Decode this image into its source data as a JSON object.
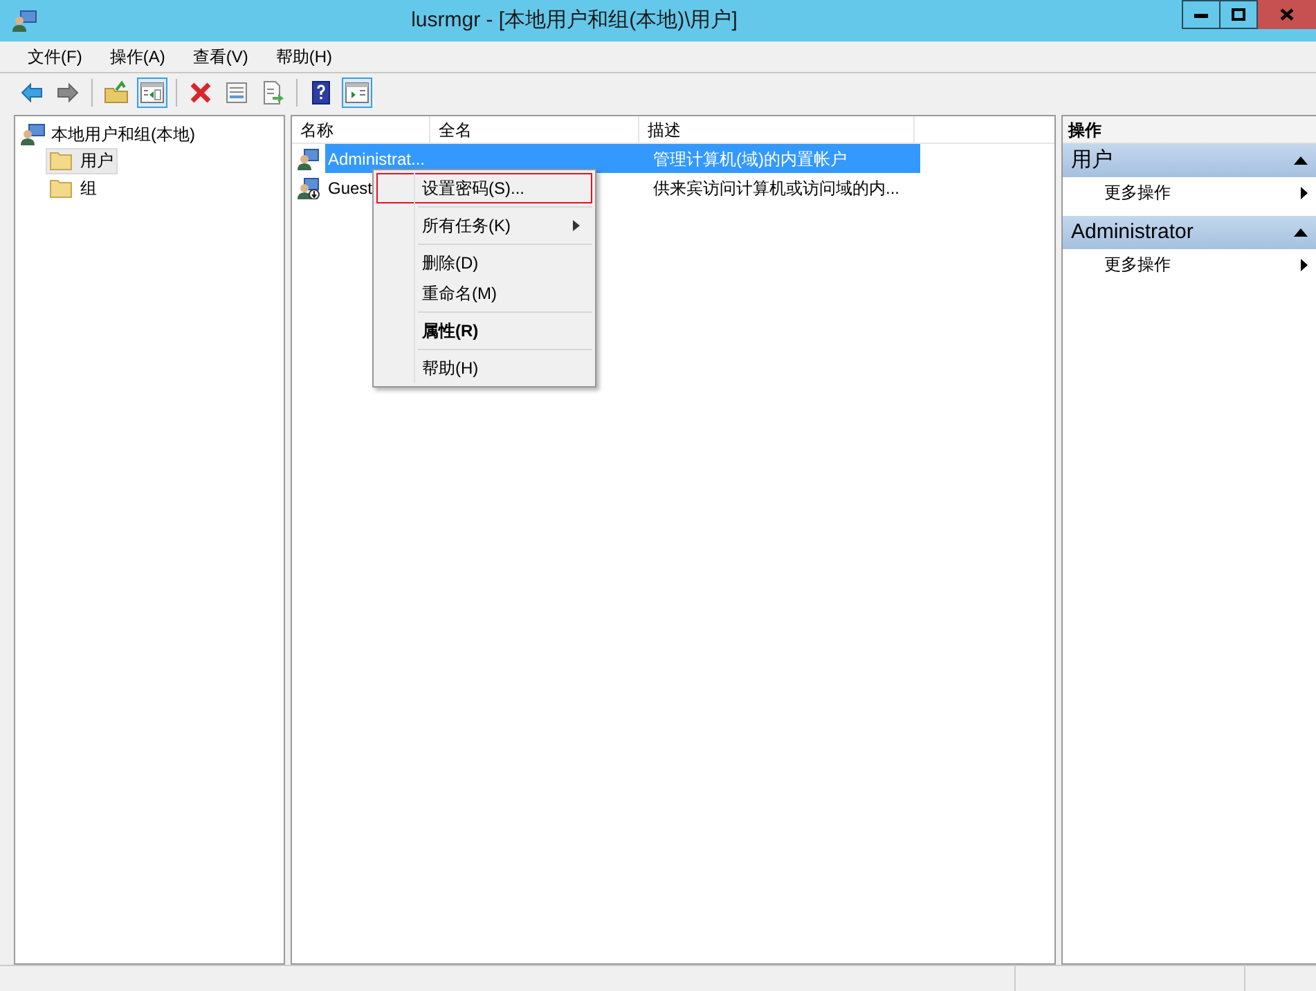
{
  "window": {
    "title": "lusrmgr - [本地用户和组(本地)\\用户]"
  },
  "menu_bar": [
    "文件(F)",
    "操作(A)",
    "查看(V)",
    "帮助(H)"
  ],
  "toolbar": [
    {
      "kind": "back",
      "pressed": false
    },
    {
      "kind": "forward",
      "pressed": false
    },
    {
      "kind": "separator"
    },
    {
      "kind": "up",
      "pressed": false
    },
    {
      "kind": "tree",
      "pressed": true
    },
    {
      "kind": "separator"
    },
    {
      "kind": "delete",
      "pressed": false
    },
    {
      "kind": "properties",
      "pressed": false
    },
    {
      "kind": "export",
      "pressed": false
    },
    {
      "kind": "separator"
    },
    {
      "kind": "help",
      "pressed": false
    },
    {
      "kind": "actionpane",
      "pressed": true
    }
  ],
  "tree": {
    "label": "本地用户和组(本地)",
    "children": [
      {
        "label": "用户",
        "selected": true
      },
      {
        "label": "组",
        "selected": false
      }
    ]
  },
  "table": {
    "columns": [
      "名称",
      "全名",
      "描述"
    ],
    "rows": [
      {
        "name": "Administrat...",
        "full_name": "",
        "description": "管理计算机(域)的内置帐户",
        "selected": true,
        "kind": "admin"
      },
      {
        "name": "Guest",
        "full_name": "",
        "description": "供来宾访问计算机或访问域的内...",
        "selected": false,
        "kind": "guest"
      }
    ]
  },
  "context_menu": [
    {
      "kind": "item",
      "label": "设置密码(S)...",
      "selected": true,
      "submenu": false,
      "default": false
    },
    {
      "kind": "separator"
    },
    {
      "kind": "item",
      "label": "所有任务(K)",
      "selected": false,
      "submenu": true,
      "default": false
    },
    {
      "kind": "separator"
    },
    {
      "kind": "item",
      "label": "删除(D)",
      "selected": false,
      "submenu": false,
      "default": false
    },
    {
      "kind": "item",
      "label": "重命名(M)",
      "selected": false,
      "submenu": false,
      "default": false
    },
    {
      "kind": "separator"
    },
    {
      "kind": "item",
      "label": "属性(R)",
      "selected": false,
      "submenu": false,
      "default": true
    },
    {
      "kind": "separator"
    },
    {
      "kind": "item",
      "label": "帮助(H)",
      "selected": false,
      "submenu": false,
      "default": false
    }
  ],
  "actions": {
    "title": "操作",
    "sections": [
      {
        "title": "用户",
        "expanded": true,
        "items": [
          "更多操作"
        ]
      },
      {
        "title": "Administrator",
        "expanded": true,
        "items": [
          "更多操作"
        ]
      }
    ]
  }
}
